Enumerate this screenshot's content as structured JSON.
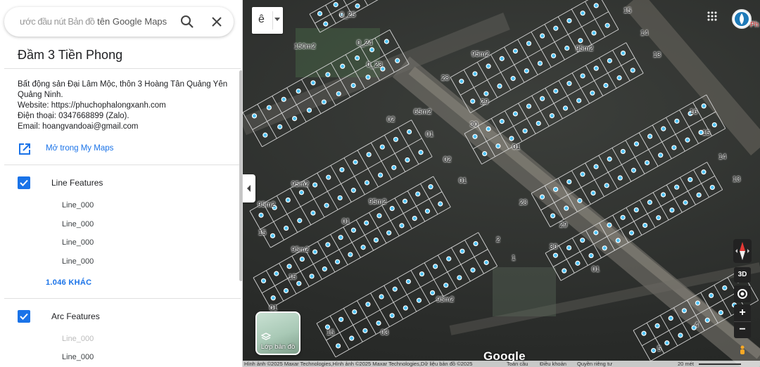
{
  "header": {
    "title_visible": "tên Google Maps",
    "title_faded": "ước đầu nút Bản đồ",
    "search_icon": "search-icon",
    "close_icon": "close-icon"
  },
  "map_info": {
    "title": "Đầm 3 Tiền Phong",
    "description": [
      "Bất động sản Đại Lâm Mộc, thôn 3 Hoàng Tân Quảng Yên",
      "Quảng Ninh.",
      "Website: https://phuchophalongxanh.com",
      "Điện thoại: 0347668899 (Zalo).",
      "Email: hoangvandoai@gmail.com"
    ],
    "open_in_mymaps": "Mở trong My Maps"
  },
  "layers": [
    {
      "name": "Line Features",
      "checked": true,
      "features": [
        "Line_000",
        "Line_000",
        "Line_000",
        "Line_000"
      ],
      "more": "1.046 KHÁC"
    },
    {
      "name": "Arc Features",
      "checked": true,
      "features": [
        "Line_000",
        "Line_000"
      ]
    }
  ],
  "map": {
    "labels": [
      "0_25",
      "0_24",
      "0_23",
      "150m2",
      "95m2",
      "95m2",
      "15",
      "14",
      "13",
      "28",
      "29",
      "30",
      "01",
      "16",
      "15",
      "14",
      "13",
      "65m2",
      "02",
      "01",
      "02",
      "01",
      "95m2",
      "95m2",
      "95m2",
      "01",
      "15",
      "95m2",
      "28",
      "29",
      "30",
      "01",
      "2",
      "1",
      "95m2",
      "15",
      "01",
      "03",
      "15",
      "4",
      "5"
    ],
    "map_type_button": "ê",
    "layer_button": "Lớp bản đồ",
    "control_3d": "3D",
    "zoom_in": "+",
    "zoom_out": "−",
    "logo": "Google",
    "footer": {
      "imagery": "Hình ảnh ©2025 Maxar Technologies,Hình ảnh ©2025 Maxar Technologies,Dữ liệu bản đồ ©2025",
      "global": "Toàn cầu",
      "terms": "Điều khoản",
      "privacy": "Quyền riêng tư",
      "scale": "20 mét"
    },
    "top_right_label": "Ph"
  },
  "colors": {
    "accent": "#1a73e8",
    "plot_line": "#d8d8d8",
    "marker": "#4fc3f7"
  }
}
